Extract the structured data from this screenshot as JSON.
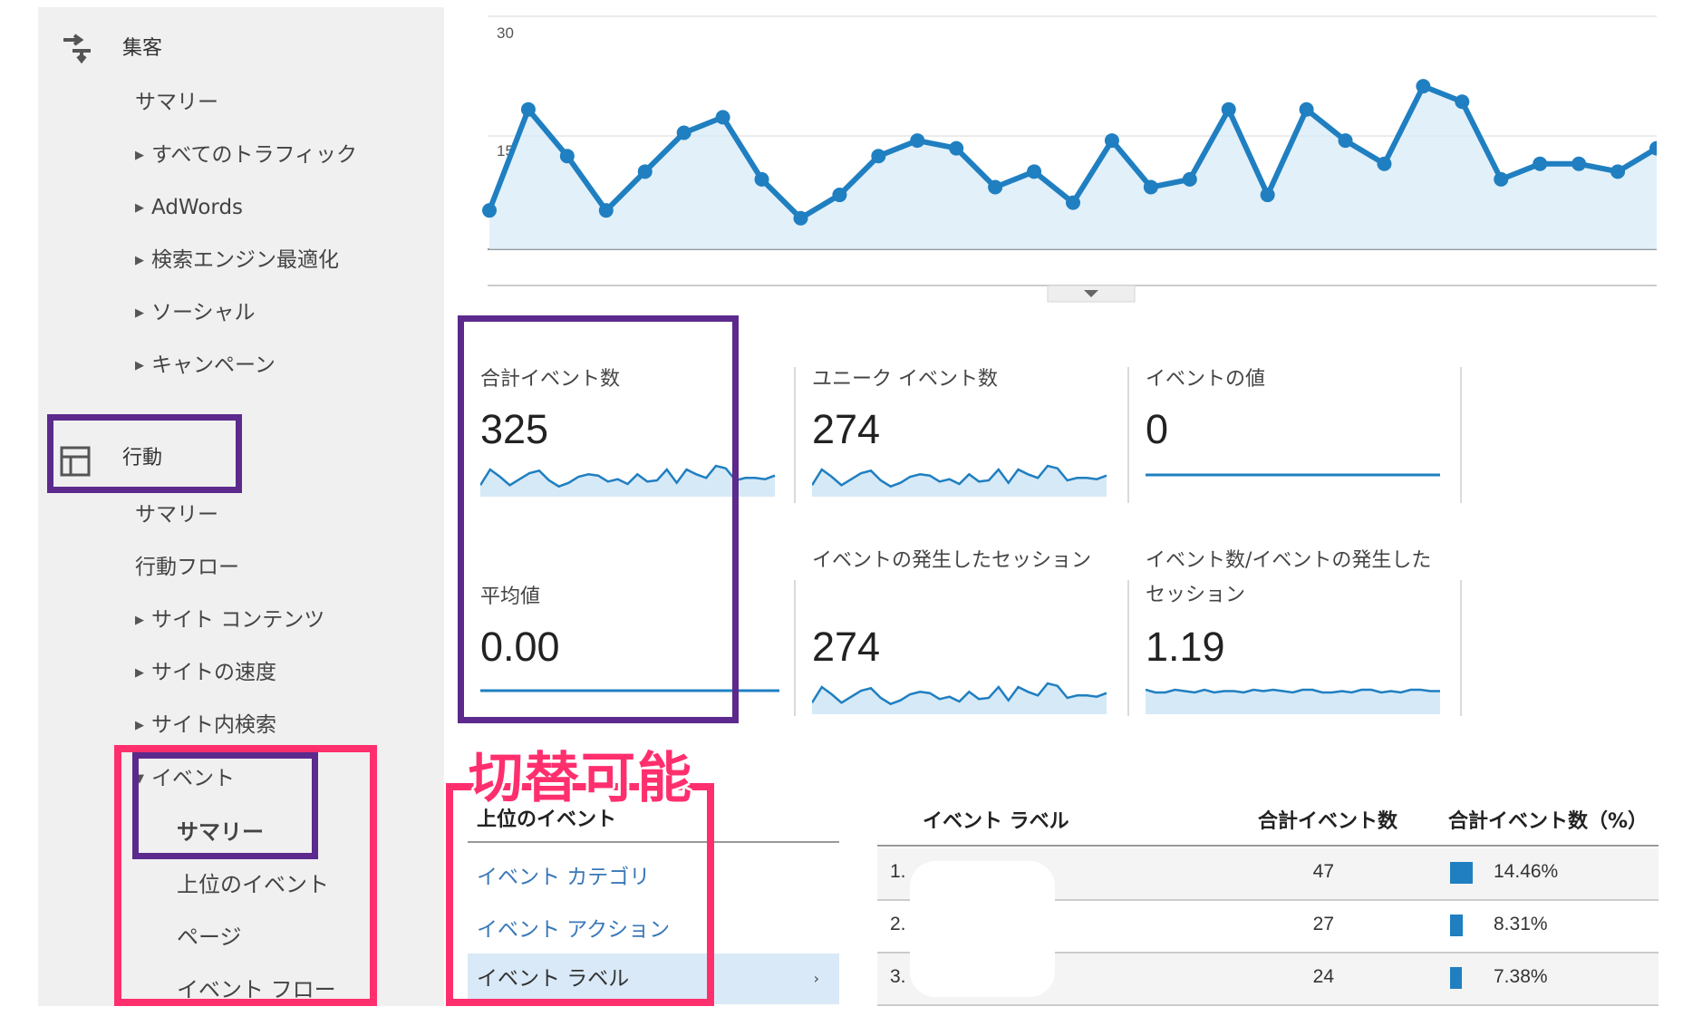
{
  "sidebar": {
    "acquisition": {
      "label": "集客",
      "items": [
        "サマリー",
        "すべてのトラフィック",
        "AdWords",
        "検索エンジン最適化",
        "ソーシャル",
        "キャンペーン"
      ]
    },
    "behavior": {
      "label": "行動",
      "items": [
        "サマリー",
        "行動フロー",
        "サイト コンテンツ",
        "サイトの速度",
        "サイト内検索"
      ],
      "events": {
        "label": "イベント",
        "items": [
          "サマリー",
          "上位のイベント",
          "ページ",
          "イベント フロー"
        ]
      }
    }
  },
  "chart": {
    "ytick_top": "30",
    "ytick_mid": "15"
  },
  "chart_data": {
    "type": "area",
    "ylim": [
      0,
      30
    ],
    "values": [
      5,
      18,
      12,
      5,
      10,
      15,
      17,
      9,
      4,
      7,
      12,
      14,
      13,
      8,
      10,
      6,
      14,
      8,
      9,
      18,
      7,
      18,
      14,
      11,
      21,
      19,
      9,
      11,
      11,
      10,
      13
    ]
  },
  "scorecards": [
    {
      "label": "合計イベント数",
      "value": "325"
    },
    {
      "label": "ユニーク イベント数",
      "value": "274"
    },
    {
      "label": "イベントの値",
      "value": "0"
    },
    {
      "label": "平均値",
      "value": "0.00"
    },
    {
      "label": "イベントの発生したセッション",
      "value": "274"
    },
    {
      "label": "イベント数/イベントの発生したセッション",
      "value": "1.19"
    }
  ],
  "annotation": {
    "switch_note": "切替可能"
  },
  "dimension_menu": {
    "header": "上位のイベント",
    "options": [
      "イベント カテゴリ",
      "イベント アクション",
      "イベント ラベル"
    ],
    "arrow": "›"
  },
  "table": {
    "headers": {
      "label": "イベント ラベル",
      "total": "合計イベント数",
      "pct": "合計イベント数（%）"
    },
    "rows": [
      {
        "num": "1.",
        "total": "47",
        "pct": "14.46%",
        "share": 14.46
      },
      {
        "num": "2.",
        "total": "27",
        "pct": "8.31%",
        "share": 8.31
      },
      {
        "num": "3.",
        "total": "24",
        "pct": "7.38%",
        "share": 7.38
      }
    ]
  },
  "colors": {
    "accent": "#1f7fc1",
    "highlight_purple": "#5b2a8c",
    "highlight_pink": "#ff2f6e"
  }
}
